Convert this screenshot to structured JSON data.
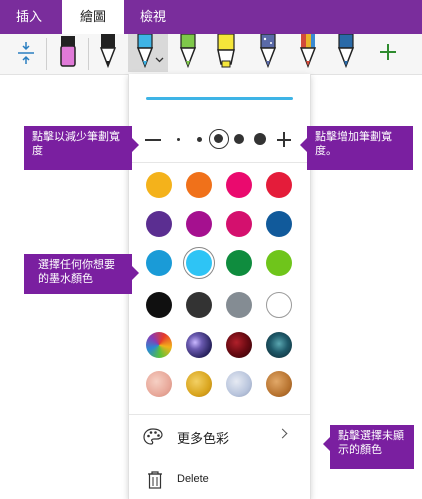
{
  "ribbon": {
    "tabs": [
      "插入",
      "繪圖",
      "檢視"
    ],
    "active_tab": "繪圖",
    "color": "#7a2d9c"
  },
  "toolbar": {
    "tools": [
      {
        "name": "insert-space-tool",
        "icon": "vertical-spacing-icon"
      },
      {
        "name": "eraser-tool",
        "icon": "eraser-icon",
        "color": "#e07ad8"
      },
      {
        "name": "pen-black",
        "icon": "pen-icon",
        "color": "#222222"
      },
      {
        "name": "pen-blue-selected",
        "icon": "pen-icon",
        "color": "#3eb4e6"
      },
      {
        "name": "pen-green",
        "icon": "pen-icon",
        "color": "#7ec84a"
      },
      {
        "name": "highlighter-yellow",
        "icon": "highlighter-icon",
        "color": "#f5e63a"
      },
      {
        "name": "pen-galaxy",
        "icon": "pen-icon",
        "color": "#5a6aa8"
      },
      {
        "name": "pen-rainbow",
        "icon": "pen-icon",
        "color": "#d24a3a"
      },
      {
        "name": "pen-ocean",
        "icon": "pen-icon",
        "color": "#2a6aa8"
      }
    ],
    "add_pen_icon": "plus-icon"
  },
  "panel": {
    "preview_color": "#3eb4e6",
    "width_row": {
      "decrease_icon": "minus-icon",
      "increase_icon": "plus-icon",
      "selected_index": 2
    },
    "colors": [
      [
        "#f4b21b",
        "#f0711a",
        "#ea0a6e",
        "#e41c3a"
      ],
      [
        "#5b2e91",
        "#a5108f",
        "#d4106e",
        "#115a9b"
      ],
      [
        "#1a9bd7",
        "#2ec4f5",
        "#0f8c3e",
        "#6fc51b"
      ],
      [
        "#101010",
        "#333333",
        "#848c93",
        "#ffffff"
      ]
    ],
    "textures": [
      "rainbow-texture",
      "galaxy-texture",
      "lava-texture",
      "ocean-texture",
      "rose-gold-texture",
      "gold-texture",
      "silver-texture",
      "bronze-texture"
    ],
    "more_colors_label": "更多色彩",
    "delete_label": "Delete"
  },
  "callouts": {
    "decrease": "點擊以減少筆劃寬度",
    "increase": "點擊增加筆劃寬度。",
    "choose_color": "選擇任何你想要的墨水顏色",
    "more_colors": "點擊選擇未顯示的顏色"
  }
}
